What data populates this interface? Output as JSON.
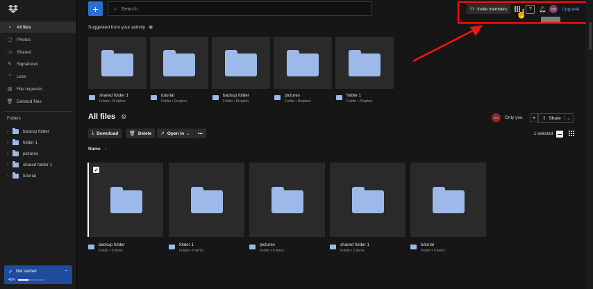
{
  "sidebar": {
    "nav": [
      {
        "label": "All files",
        "icon": "all-files-icon",
        "active": true
      },
      {
        "label": "Photos",
        "icon": "photos-icon"
      },
      {
        "label": "Shared",
        "icon": "shared-icon"
      },
      {
        "label": "Signatures",
        "icon": "signatures-icon"
      },
      {
        "label": "Less",
        "icon": "chevron-up-icon"
      },
      {
        "label": "File requests",
        "icon": "file-requests-icon"
      },
      {
        "label": "Deleted files",
        "icon": "trash-icon"
      }
    ],
    "folders_heading": "Folders",
    "folders": [
      "backup folder",
      "folder 1",
      "pictures",
      "shared folder 1",
      "tutorial"
    ],
    "get_started": {
      "label": "Get started",
      "progress_label": "40%",
      "progress": 0.4
    }
  },
  "topbar": {
    "search_placeholder": "Search",
    "invite_label": "Invite members",
    "avatar_initials": "GG",
    "upgrade_label": "Upgrade"
  },
  "suggested": {
    "title": "Suggested from your activity",
    "items": [
      {
        "name": "shared folder 1",
        "sub": "Folder • Dropbox"
      },
      {
        "name": "tutorial",
        "sub": "Folder • Dropbox"
      },
      {
        "name": "backup folder",
        "sub": "Folder • Dropbox"
      },
      {
        "name": "pictures",
        "sub": "Folder • Dropbox"
      },
      {
        "name": "folder 1",
        "sub": "Folder • Dropbox"
      }
    ]
  },
  "allfiles": {
    "title": "All files",
    "only_you": "Only you",
    "owner_initials": "GG",
    "share_label": "Share",
    "actions": {
      "download": "Download",
      "delete": "Delete",
      "open_in": "Open in",
      "more": "•••"
    },
    "selected_text": "1 selected",
    "name_header": "Name",
    "sort_arrow": "↑",
    "items": [
      {
        "name": "backup folder",
        "sub": "Folder • 0 items",
        "selected": true
      },
      {
        "name": "folder 1",
        "sub": "Folder • 0 items"
      },
      {
        "name": "pictures",
        "sub": "Folder • 0 items"
      },
      {
        "name": "shared folder 1",
        "sub": "Folder • 0 items"
      },
      {
        "name": "tutorial",
        "sub": "Folder • 0 items"
      }
    ]
  },
  "colors": {
    "accent": "#2b6fd6",
    "folder": "#9cb9ea",
    "annotation": "#ff1010"
  }
}
